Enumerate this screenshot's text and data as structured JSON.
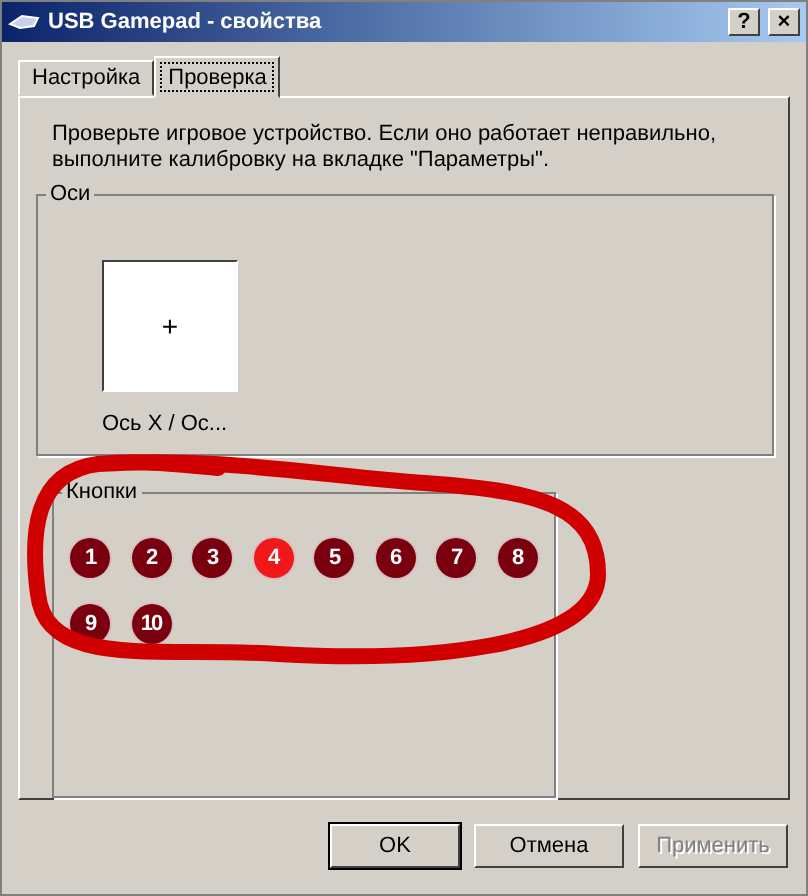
{
  "window": {
    "title": "USB Gamepad  - свойства",
    "help_button": "?",
    "close_button": "×"
  },
  "tabs": [
    {
      "label": "Настройка",
      "selected": false
    },
    {
      "label": "Проверка",
      "selected": true
    }
  ],
  "description": "Проверьте игровое устройство. Если оно работает неправильно, выполните калибровку на вкладке \"Параметры\".",
  "axes": {
    "title": "Оси",
    "crosshair": "+",
    "label": "Ось X / Ос..."
  },
  "buttons_group": {
    "title": "Кнопки",
    "buttons": [
      {
        "label": "1",
        "on": false
      },
      {
        "label": "2",
        "on": false
      },
      {
        "label": "3",
        "on": false
      },
      {
        "label": "4",
        "on": true
      },
      {
        "label": "5",
        "on": false
      },
      {
        "label": "6",
        "on": false
      },
      {
        "label": "7",
        "on": false
      },
      {
        "label": "8",
        "on": false
      },
      {
        "label": "9",
        "on": false
      },
      {
        "label": "10",
        "on": false
      }
    ]
  },
  "dialog_buttons": [
    {
      "label": "OK",
      "disabled": false
    },
    {
      "label": "Отмена",
      "disabled": false
    },
    {
      "label": "Применить",
      "disabled": true
    }
  ]
}
